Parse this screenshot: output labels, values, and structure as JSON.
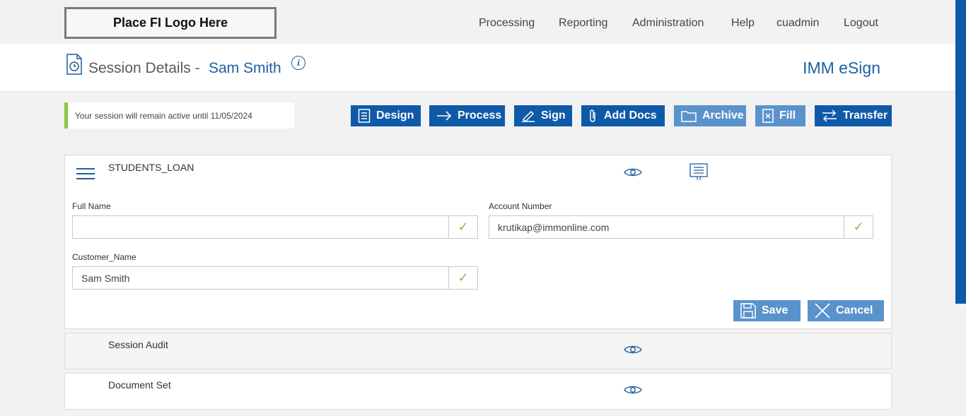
{
  "header": {
    "logo_text": "Place FI Logo Here",
    "nav": [
      "Processing",
      "Reporting",
      "Administration",
      "Help",
      "cuadmin",
      "Logout"
    ]
  },
  "title": {
    "prefix": "Session Details - ",
    "name": "Sam Smith",
    "info_glyph": "i",
    "brand": "IMM eSign"
  },
  "session_note": "Your session will remain active until 11/05/2024",
  "actions": [
    "Design",
    "Process",
    "Sign",
    "Add Docs",
    "Archive",
    "Fill",
    "Transfer"
  ],
  "form_panel": {
    "title": "STUDENTS_LOAN",
    "fields": [
      {
        "label": "Full Name",
        "value": ""
      },
      {
        "label": "Account Number",
        "value": "krutikap@immonline.com"
      },
      {
        "label": "Customer_Name",
        "value": "Sam Smith"
      }
    ],
    "check_glyph": "✓",
    "save_label": "Save",
    "cancel_label": "Cancel"
  },
  "sections": [
    "Session Audit",
    "Document Set"
  ],
  "colors": {
    "primary": "#0f5aa8",
    "disabled": "#5a93cc",
    "accent_green": "#8cc63f",
    "link_blue": "#1f5fa0"
  }
}
